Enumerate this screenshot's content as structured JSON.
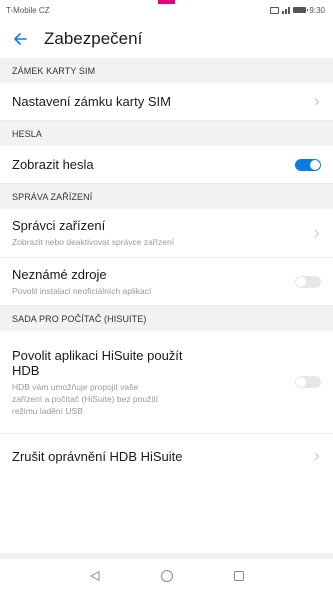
{
  "status_bar": {
    "carrier": "T-Mobile CZ",
    "time": "9:30"
  },
  "header": {
    "title": "Zabezpečení",
    "back_icon": "arrow-left-icon"
  },
  "sections": {
    "sim_lock": {
      "header": "ZÁMEK KARTY SIM",
      "sim_lock_settings": {
        "title": "Nastavení zámku karty SIM"
      }
    },
    "passwords": {
      "header": "HESLA",
      "show_passwords": {
        "title": "Zobrazit hesla",
        "toggle": "on"
      }
    },
    "device_management": {
      "header": "SPRÁVA ZAŘÍZENÍ",
      "device_admins": {
        "title": "Správci zařízení",
        "subtitle": "Zobrazit nebo deaktivovat správce zařízení"
      },
      "unknown_sources": {
        "title": "Neznámé zdroje",
        "subtitle": "Povolit instalaci neoficiálních aplikací",
        "toggle": "off"
      }
    },
    "hisuite": {
      "header": "SADA PRO POČÍTAČ (HISUITE)",
      "allow_hdb": {
        "title_line1": "Povolit aplikaci HiSuite použít",
        "title_line2": "HDB",
        "subtitle_line1": "HDB vám umožňuje propojit vaše",
        "subtitle_line2": "zařízení a počítač (HiSuite) bez použití",
        "subtitle_line3": "režimu ladění USB",
        "toggle": "off"
      },
      "revoke_hdb": {
        "title": "Zrušit oprávnění HDB HiSuite"
      }
    }
  },
  "colors": {
    "accent": "#0a7de0",
    "brand_mark": "#e4007f"
  },
  "nav": {
    "back_icon": "triangle-back-icon",
    "home_icon": "circle-home-icon",
    "recents_icon": "square-recents-icon"
  }
}
